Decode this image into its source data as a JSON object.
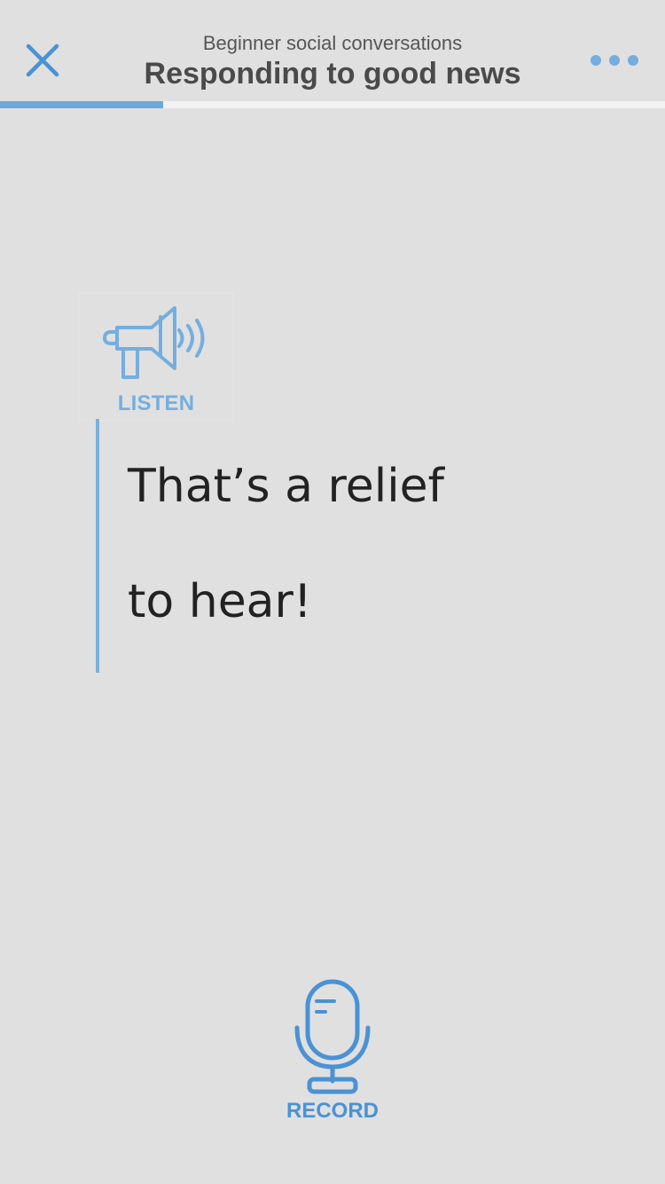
{
  "header": {
    "subtitle": "Beginner social conversations",
    "title": "Responding to good news",
    "close_icon": "close-icon",
    "more_icon": "more-icon"
  },
  "progress": {
    "fraction": 0.245
  },
  "listen": {
    "label": "LISTEN",
    "icon": "megaphone-icon"
  },
  "phrase": {
    "line1": "That’s a relief",
    "line2": "to hear!"
  },
  "record": {
    "label": "RECORD",
    "icon": "microphone-icon"
  },
  "colors": {
    "background": "#e0e0e0",
    "accent": "#4a92d4",
    "accent_light": "#74aee0",
    "text": "#222222"
  }
}
